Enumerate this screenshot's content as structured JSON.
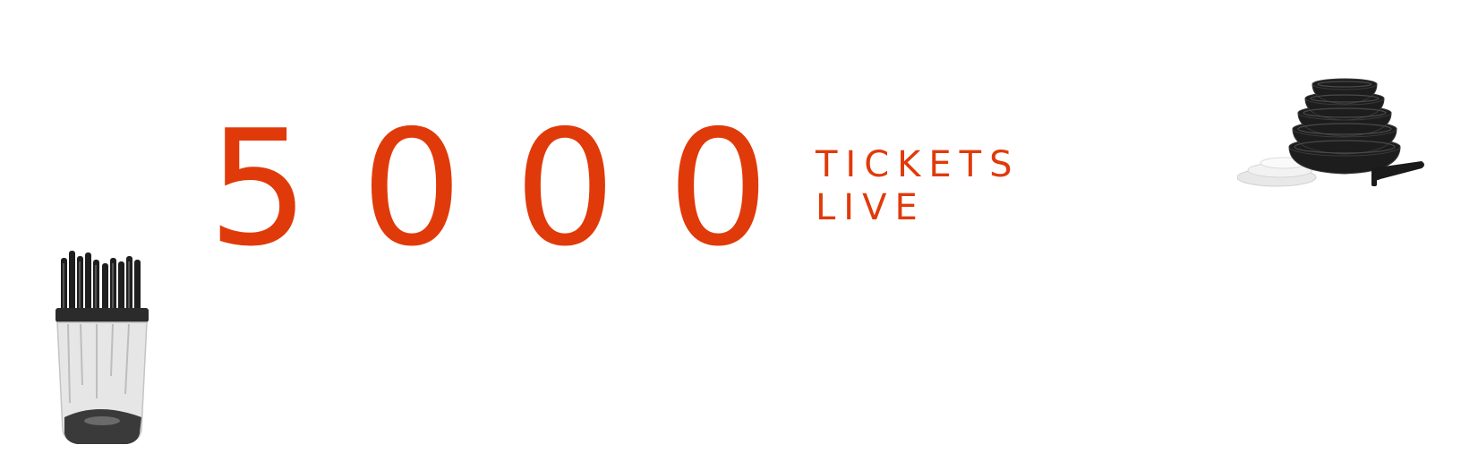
{
  "counter": {
    "number": "5000",
    "line1": "TICKETS",
    "line2": "LIVE"
  },
  "images": {
    "left": "knife-block-set",
    "right": "stacked-cookware-set"
  },
  "colors": {
    "accent": "#e03a0a",
    "background": "#ffffff"
  }
}
